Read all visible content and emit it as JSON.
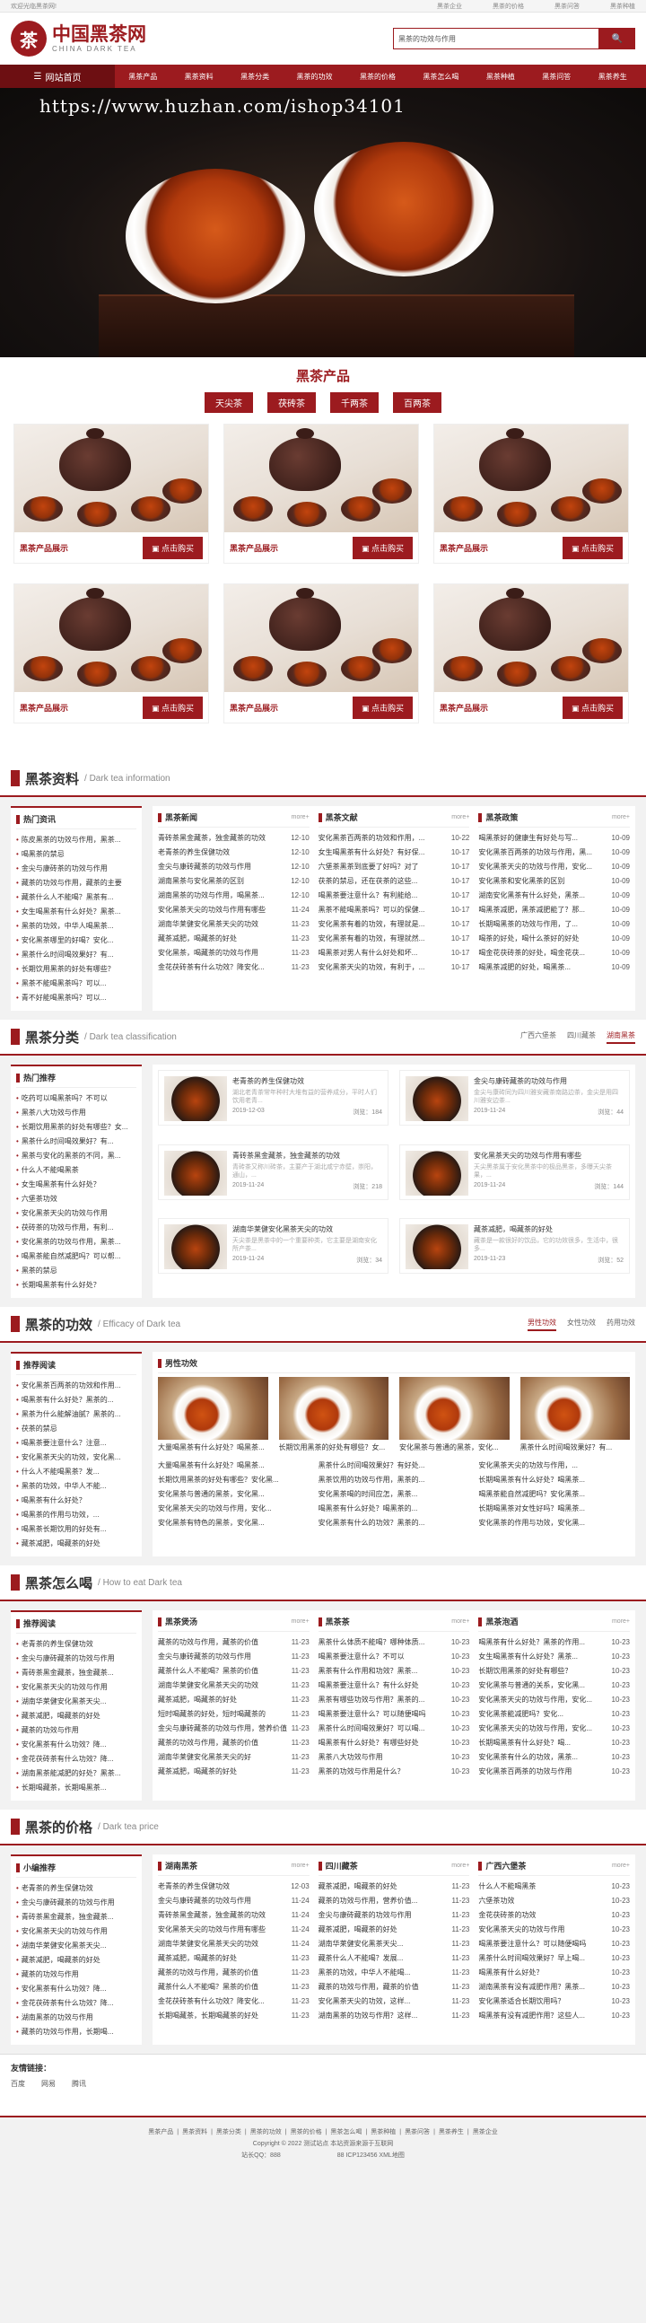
{
  "topbar": {
    "left": "欢迎光临黑茶网!",
    "links": [
      "黑茶企业",
      "黑茶的价格",
      "黑茶问答",
      "黑茶种植"
    ]
  },
  "header": {
    "logo_char": "茶",
    "logo_cn": "中国黑茶网",
    "logo_en": "CHINA DARK TEA",
    "search_placeholder": "黑茶的功效与作用",
    "search_btn": "🔍"
  },
  "nav": {
    "home": "网站首页",
    "items": [
      "黑茶产品",
      "黑茶资料",
      "黑茶分类",
      "黑茶的功效",
      "黑茶的价格",
      "黑茶怎么喝",
      "黑茶种植",
      "黑茶问答",
      "黑茶养生"
    ]
  },
  "banner": {
    "url": "https://www.huzhan.com/ishop34101"
  },
  "products": {
    "title": "黑茶产品",
    "tabs": [
      "天尖茶",
      "茯砖茶",
      "千两茶",
      "百两茶"
    ],
    "name": "黑茶产品展示",
    "buy": "点击购买",
    "count": 6
  },
  "s1": {
    "title": "黑茶资料",
    "sub": "/ Dark tea information",
    "left_title": "热门资讯",
    "left": [
      "陈皮黑茶的功效与作用，黑茶...",
      "喝黑茶的禁忌",
      "金尖与康砖茶的功效与作用",
      "藏茶的功效与作用，藏茶的主要",
      "藏茶什么人不能喝？黑茶有...",
      "女生喝黑茶有什么好处？黑茶...",
      "黑茶的功效，中华人喝黑茶...",
      "安化黑茶哪里的好喝？安化...",
      "黑茶什么时间喝效果好？有...",
      "长期饮用黑茶的好处有哪些？",
      "黑茶不能喝黑茶吗？可以...",
      "青不好能喝黑茶吗？可以..."
    ],
    "cols": [
      {
        "title": "黑茶新闻",
        "more": "more+",
        "rows": [
          [
            "青砖茶黑金藏茶，独金藏茶的功效",
            "12-10"
          ],
          [
            "老青茶的养生保健功效",
            "12-10"
          ],
          [
            "金尖与康砖藏茶的功效与作用",
            "12-10"
          ],
          [
            "湖南黑茶与安化黑茶的区别",
            "12-10"
          ],
          [
            "湖南黑茶的功效与作用，喝黑茶...",
            "12-10"
          ],
          [
            "安化黑茶天尖的功效与作用有哪些",
            "11-24"
          ],
          [
            "湖南华莱健安化黑茶天尖的功效",
            "11-23"
          ],
          [
            "藏茶减肥，喝藏茶的好处",
            "11-23"
          ],
          [
            "安化黑茶，喝藏茶的功效与作用",
            "11-23"
          ],
          [
            "金花茯砖茶有什么功效？降安化...",
            "11-23"
          ]
        ]
      },
      {
        "title": "黑茶文献",
        "more": "more+",
        "rows": [
          [
            "安化黑茶百两茶的功效和作用，...",
            "10-22"
          ],
          [
            "女生喝黑茶有什么好处？有好保...",
            "10-17"
          ],
          [
            "六堡茶黑茶到底要了好吗？对了",
            "10-17"
          ],
          [
            "茯茶的禁忌，还在茯茶的这些...",
            "10-17"
          ],
          [
            "喝黑茶要注意什么？有利能给...",
            "10-17"
          ],
          [
            "黑茶不能喝黑茶吗？可以的保健...",
            "10-17"
          ],
          [
            "安化黑茶有着的功效，有理就是...",
            "10-17"
          ],
          [
            "安化黑茶有着的功效，有理就然...",
            "10-17"
          ],
          [
            "喝黑茶对男人有什么好处和坏...",
            "10-17"
          ],
          [
            "安化黑茶天尖的功效，有利于，...",
            "10-17"
          ]
        ]
      },
      {
        "title": "黑茶政策",
        "more": "more+",
        "rows": [
          [
            "喝黑茶好的健康生有好处与写...",
            "10-09"
          ],
          [
            "安化黑茶百两茶的功效与作用，黑...",
            "10-09"
          ],
          [
            "安化黑茶天尖的功效与作用，安化...",
            "10-09"
          ],
          [
            "安化黑茶和安化黑茶的区别",
            "10-09"
          ],
          [
            "湖南安化黑茶有什么好处，黑茶...",
            "10-09"
          ],
          [
            "喝黑茶减肥，黑茶减肥能了？那...",
            "10-09"
          ],
          [
            "长期喝黑茶的功效与作用，了...",
            "10-09"
          ],
          [
            "喝茶的好处，喝什么茶好的好处",
            "10-09"
          ],
          [
            "喝金花茯砖茶的好处，喝金花茯...",
            "10-09"
          ],
          [
            "喝黑茶减肥的好处，喝黑茶...",
            "10-09"
          ]
        ]
      }
    ]
  },
  "s2": {
    "title": "黑茶分类",
    "sub": "/ Dark tea classification",
    "tabs": [
      "广西六堡茶",
      "四川藏茶",
      "湖南黑茶"
    ],
    "active_tab": 2,
    "left_title": "热门推荐",
    "left": [
      "吃药可以喝黑茶吗？不可以",
      "黑茶八大功效与作用",
      "长期饮用黑茶的好处有哪些？女...",
      "黑茶什么时间喝效果好？有...",
      "黑茶与安化的黑茶的不同，黑...",
      "什么人不能喝黑茶",
      "女生喝黑茶有什么好处？",
      "六堡茶功效",
      "安化黑茶天尖的功效与作用",
      "茯砖茶的功效与作用，有利...",
      "安化黑茶的功效与作用，黑茶...",
      "喝黑茶能自然减肥吗？可以帮...",
      "黑茶的禁忌",
      "长期喝黑茶有什么好处？"
    ],
    "articles": [
      {
        "t": "老青茶的养生保健功效",
        "ds": "湖北老青茶常年种村大堆有益的营养成分，平时人们饮用老青...",
        "date": "2019-12-03",
        "hits": "浏览：184"
      },
      {
        "t": "金尖与康砖藏茶的功效与作用",
        "ds": "金尖与康砖同为四川雅安藏茶南路边茶，金尖是用四川雅安边茶...",
        "date": "2019-11-24",
        "hits": "浏览：44"
      },
      {
        "t": "青砖茶黑金藏茶，独金藏茶的功效",
        "ds": "青砖茶又称川砖茶，主要产于湖北咸宁赤壁，崇阳，通山，...",
        "date": "2019-11-24",
        "hits": "浏览：218"
      },
      {
        "t": "安化黑茶天尖的功效与作用有哪些",
        "ds": "天尖黑茶属于安化黑茶中的极品黑茶，多曝天尖茶果，...",
        "date": "2019-11-24",
        "hits": "浏览：144"
      },
      {
        "t": "湖南华莱健安化黑茶天尖的功效",
        "ds": "天尖茶是黑茶中的一个重要种类，它主要是湖南安化所产茶...",
        "date": "2019-11-24",
        "hits": "浏览：34"
      },
      {
        "t": "藏茶减肥，喝藏茶的好处",
        "ds": "藏茶是一款很好的饮品，它的功效很多，生活中，很多...",
        "date": "2019-11-23",
        "hits": "浏览：52"
      }
    ]
  },
  "s3": {
    "title": "黑茶的功效",
    "sub": "/ Efficacy of Dark tea",
    "tabs": [
      "男性功效",
      "女性功效",
      "药用功效"
    ],
    "active_tab": 0,
    "left_title": "推荐阅读",
    "left": [
      "安化黑茶百两茶的功效和作用...",
      "喝黑茶有什么好处？黑茶的...",
      "黑茶为什么能解油腻？黑茶的...",
      "茯茶的禁忌",
      "喝黑茶要注意什么？注意...",
      "安化黑茶天尖的功效，安化黑...",
      "什么人不能喝黑茶？发...",
      "黑茶的功效，中华人不能...",
      "喝黑茶有什么好处？",
      "喝黑茶的作用与功效，...",
      "喝黑茶长期饮用的好处有...",
      "藏茶减肥，喝藏茶的好处"
    ],
    "panel_title": "男性功效",
    "imgs": [
      "大量喝黑茶有什么好处？喝黑茶...",
      "长期饮用黑茶的好处有哪些？女...",
      "安化黑茶与普通的黑茶，安化...",
      "黑茶什么时间喝效果好？有..."
    ],
    "rows": [
      [
        "大量喝黑茶有什么好处？喝黑茶...",
        "黑茶什么时间喝效果好？有好处...",
        "安化黑茶天尖的功效与作用，..."
      ],
      [
        "长期饮用黑茶的好处有哪些？安化黑...",
        "黑茶饮用的功效与作用，黑茶的...",
        "长期喝黑茶有什么好处？喝黑茶..."
      ],
      [
        "安化黑茶与普通的黑茶，安化黑...",
        "安化黑茶喝的时间应怎，黑茶...",
        "喝黑茶能自然减肥吗？安化黑茶..."
      ],
      [
        "安化黑茶天尖的功效与作用，安化...",
        "喝黑茶有什么好处？喝黑茶的...",
        "长期喝黑茶对女性好吗？喝黑茶..."
      ],
      [
        "安化黑茶有特色的黑茶，安化黑...",
        "安化黑茶有什么的功效？黑茶的...",
        "安化黑茶的作用与功效，安化黑..."
      ]
    ]
  },
  "s4": {
    "title": "黑茶怎么喝",
    "sub": "/ How to eat Dark tea",
    "left_title": "推荐阅读",
    "left": [
      "老青茶的养生保健功效",
      "金尖与康砖藏茶的功效与作用",
      "青砖茶黑金藏茶，独金藏茶...",
      "安化黑茶天尖的功效与作用",
      "湖南华莱健安化黑茶天尖...",
      "藏茶减肥，喝藏茶的好处",
      "藏茶的功效与作用",
      "安化黑茶有什么功效？降...",
      "金花茯砖茶有什么功效？降...",
      "湖南黑茶能减肥的好处？黑茶...",
      "长期喝藏茶，长期喝黑茶..."
    ],
    "cols": [
      {
        "title": "黑茶煲汤",
        "more": "more+",
        "rows": [
          [
            "藏茶的功效与作用，藏茶的价值",
            "11-23"
          ],
          [
            "金尖与康砖藏茶的功效与作用",
            "11-23"
          ],
          [
            "藏茶什么人不能喝？黑茶的价值",
            "11-23"
          ],
          [
            "湖南华莱健安化黑茶天尖的功效",
            "11-23"
          ],
          [
            "藏茶减肥，喝藏茶的好处",
            "11-23"
          ],
          [
            "短时喝藏茶的好处，短时喝藏茶的",
            "11-23"
          ],
          [
            "金尖与康砖藏茶的功效与作用，营养价值",
            "11-23"
          ],
          [
            "藏茶的功效与作用，藏茶的价值",
            "11-23"
          ],
          [
            "湖南华莱健安化黑茶天尖的好",
            "11-23"
          ],
          [
            "藏茶减肥，喝藏茶的好处",
            "11-23"
          ]
        ]
      },
      {
        "title": "黑茶茶",
        "more": "more+",
        "rows": [
          [
            "黑茶什么体质不能喝？哪种体质...",
            "10-23"
          ],
          [
            "喝黑茶要注意什么？不可以",
            "10-23"
          ],
          [
            "黑茶有什么作用和功效？黑茶...",
            "10-23"
          ],
          [
            "喝黑茶要注意什么？有什么好处",
            "10-23"
          ],
          [
            "黑茶有哪些功效与作用？黑茶的...",
            "10-23"
          ],
          [
            "喝黑茶要注意什么？可以随便喝吗",
            "10-23"
          ],
          [
            "黑茶什么时间喝效果好？可以喝...",
            "10-23"
          ],
          [
            "喝黑茶有什么好处？有哪些好处",
            "10-23"
          ],
          [
            "黑茶八大功效与作用",
            "10-23"
          ],
          [
            "黑茶的功效与作用是什么？",
            "10-23"
          ]
        ]
      },
      {
        "title": "黑茶泡酒",
        "more": "more+",
        "rows": [
          [
            "喝黑茶有什么好处？黑茶的作用...",
            "10-23"
          ],
          [
            "女生喝黑茶有什么好处？黑茶...",
            "10-23"
          ],
          [
            "长期饮用黑茶的好处有哪些？",
            "10-23"
          ],
          [
            "安化黑茶与普通的关系，安化黑...",
            "10-23"
          ],
          [
            "安化黑茶天尖的功效与作用，安化...",
            "10-23"
          ],
          [
            "安化黑茶能减肥吗？安化...",
            "10-23"
          ],
          [
            "安化黑茶天尖的功效与作用，安化...",
            "10-23"
          ],
          [
            "长期喝黑茶有什么好处？喝...",
            "10-23"
          ],
          [
            "安化黑茶有什么的功效，黑茶...",
            "10-23"
          ],
          [
            "安化黑茶百两茶的功效与作用",
            "10-23"
          ]
        ]
      }
    ]
  },
  "s5": {
    "title": "黑茶的价格",
    "sub": "/ Dark tea price",
    "left_title": "小编推荐",
    "left": [
      "老青茶的养生保健功效",
      "金尖与康砖藏茶的功效与作用",
      "青砖茶黑金藏茶，独金藏茶...",
      "安化黑茶天尖的功效与作用",
      "湖南华莱健安化黑茶天尖...",
      "藏茶减肥，喝藏茶的好处",
      "藏茶的功效与作用",
      "安化黑茶有什么功效？降...",
      "金花茯砖茶有什么功效？降...",
      "湖南黑茶的功效与作用",
      "藏茶的功效与作用，长期喝..."
    ],
    "cols": [
      {
        "title": "湖南黑茶",
        "more": "more+",
        "rows": [
          [
            "老青茶的养生保健功效",
            "12-03"
          ],
          [
            "金尖与康砖藏茶的功效与作用",
            "11-24"
          ],
          [
            "青砖茶黑金藏茶，独金藏茶的功效",
            "11-24"
          ],
          [
            "安化黑茶天尖的功效与作用有哪些",
            "11-24"
          ],
          [
            "湖南华莱健安化黑茶天尖的功效",
            "11-24"
          ],
          [
            "藏茶减肥，喝藏茶的好处",
            "11-23"
          ],
          [
            "藏茶的功效与作用，藏茶的价值",
            "11-23"
          ],
          [
            "藏茶什么人不能喝？黑茶的价值",
            "11-23"
          ],
          [
            "金花茯砖茶有什么功效？降安化...",
            "11-23"
          ],
          [
            "长期喝藏茶，长期喝藏茶的好处",
            "11-23"
          ]
        ]
      },
      {
        "title": "四川藏茶",
        "more": "more+",
        "rows": [
          [
            "藏茶减肥，喝藏茶的好处",
            "11-23"
          ],
          [
            "藏茶的功效与作用，营养价值...",
            "11-23"
          ],
          [
            "金尖与康砖藏茶的功效与作用",
            "11-23"
          ],
          [
            "藏茶减肥，喝藏茶的好处",
            "11-23"
          ],
          [
            "湖南华莱健安化黑茶天尖...",
            "11-23"
          ],
          [
            "藏茶什么人不能喝？发展...",
            "11-23"
          ],
          [
            "黑茶的功效，中华人不能喝...",
            "11-23"
          ],
          [
            "藏茶的功效与作用，藏茶的价值",
            "11-23"
          ],
          [
            "安化黑茶天尖的功效，这样...",
            "11-23"
          ],
          [
            "湖南黑茶的功效与作用？这样...",
            "11-23"
          ]
        ]
      },
      {
        "title": "广西六堡茶",
        "more": "more+",
        "rows": [
          [
            "什么人不能喝黑茶",
            "10-23"
          ],
          [
            "六堡茶功效",
            "10-23"
          ],
          [
            "金花茯砖茶的功效",
            "10-23"
          ],
          [
            "安化黑茶天尖的功效与作用",
            "10-23"
          ],
          [
            "喝黑茶要注意什么？可以随便喝吗",
            "10-23"
          ],
          [
            "黑茶什么时间喝效果好？早上喝...",
            "10-23"
          ],
          [
            "喝黑茶有什么好处？",
            "10-23"
          ],
          [
            "湖南黑茶有没有减肥作用？黑茶...",
            "10-23"
          ],
          [
            "安化黑茶适合长期饮用吗？",
            "10-23"
          ],
          [
            "喝黑茶有没有减肥作用？这些人...",
            "10-23"
          ]
        ]
      }
    ]
  },
  "links": {
    "title": "友情链接：",
    "items": [
      "百度",
      "网易",
      "腾讯"
    ]
  },
  "footer": {
    "nav": [
      "黑茶产品",
      "黑茶资料",
      "黑茶分类",
      "黑茶的功效",
      "黑茶的价格",
      "黑茶怎么喝",
      "黑茶种植",
      "黑茶问答",
      "黑茶养生",
      "黑茶企业"
    ],
    "copy": "Copyright © 2022 测试站点 本站资源来源于互联网",
    "icp": "站长QQ：888　　　　　　　　　88 ICP123456 XML地图"
  }
}
